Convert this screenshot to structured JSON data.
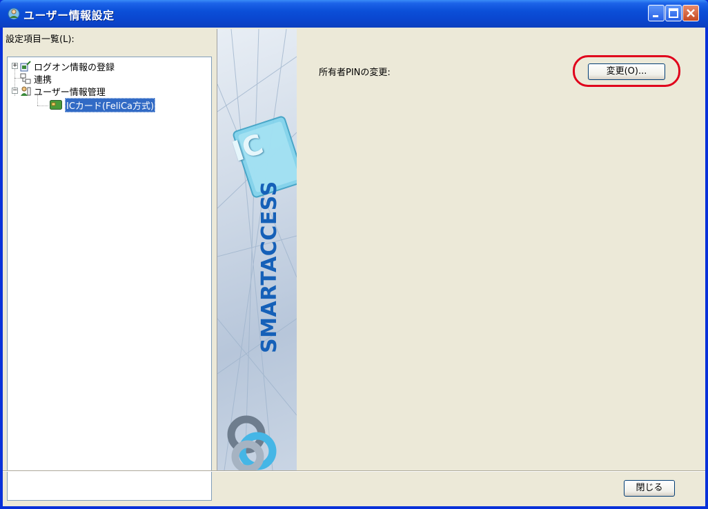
{
  "window": {
    "title": "ユーザー情報設定",
    "app_icon": "user-settings-icon",
    "controls": [
      "minimize-icon",
      "maximize-icon",
      "close-icon"
    ]
  },
  "left_panel": {
    "label": "設定項目一覧(L):",
    "tree": [
      {
        "label": "ログオン情報の登録",
        "icon": "logon-info-icon",
        "expander": "+"
      },
      {
        "label": "連携",
        "icon": "link-icon",
        "expander": ""
      },
      {
        "label": "ユーザー情報管理",
        "icon": "user-management-icon",
        "expander": "−"
      },
      {
        "label": "ICカード(FeliCa方式)",
        "icon": "ic-card-icon",
        "expander": "",
        "selected": true
      }
    ]
  },
  "banner": {
    "text": "SMARTACCESS",
    "badge": "IC"
  },
  "content": {
    "pin_label": "所有者PINの変更:",
    "change_button": "変更(O)..."
  },
  "footer": {
    "close_button": "閉じる"
  },
  "colors": {
    "titlebar": "#0b4fd8",
    "highlight": "#e0001b",
    "selection": "#316ac5",
    "banner_text": "#1560b8"
  }
}
